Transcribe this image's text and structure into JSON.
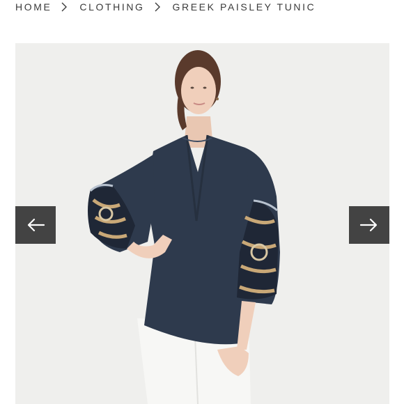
{
  "breadcrumb": {
    "items": [
      {
        "label": "HOME"
      },
      {
        "label": "CLOTHING"
      }
    ],
    "current": "GREEK PAISLEY TUNIC"
  },
  "gallery": {
    "prev_icon": "arrow-left-icon",
    "next_icon": "arrow-right-icon"
  },
  "colors": {
    "tunic": "#2e3a4d",
    "nav_button": "#434343",
    "background": "#efefed"
  }
}
